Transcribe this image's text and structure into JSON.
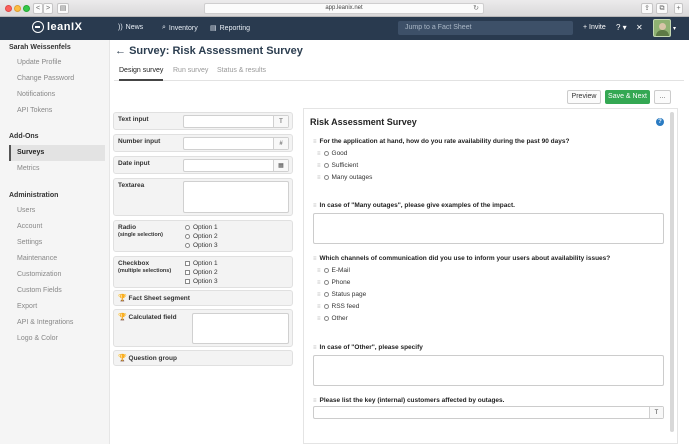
{
  "browser": {
    "url": "app.leanix.net",
    "back": "<",
    "forward": ">",
    "sidebar_toggle": "▤",
    "reload": "↻",
    "share": "⇪",
    "tabs": "⧉",
    "plus": "+"
  },
  "header": {
    "logo": "leanIX",
    "nav": [
      {
        "label": "News",
        "icon": "rss-icon"
      },
      {
        "label": "Inventory",
        "icon": "search-icon"
      },
      {
        "label": "Reporting",
        "icon": "chart-icon"
      }
    ],
    "search_placeholder": "Jump to a Fact Sheet",
    "invite": "+ Invite",
    "help": "?",
    "settings": "✕"
  },
  "sidebar": {
    "user_name": "Sarah Weissenfels",
    "user_items": [
      "Update Profile",
      "Change Password",
      "Notifications",
      "API Tokens"
    ],
    "addons_title": "Add-Ons",
    "addons_items": [
      "Surveys",
      "Metrics"
    ],
    "admin_title": "Administration",
    "admin_items": [
      "Users",
      "Account",
      "Settings",
      "Maintenance",
      "Customization",
      "Custom Fields",
      "Export",
      "API & Integrations",
      "Logo & Color"
    ]
  },
  "page": {
    "back": "←",
    "title": "Survey: Risk Assessment Survey",
    "tabs": [
      "Design survey",
      "Run survey",
      "Status & results"
    ],
    "preview_btn": "Preview",
    "save_btn": "Save & Next",
    "more_btn": "..."
  },
  "palette": {
    "text_input": "Text input",
    "text_icon": "T",
    "number_input": "Number input",
    "number_icon": "#",
    "date_input": "Date input",
    "date_icon": "▦",
    "textarea": "Textarea",
    "radio": "Radio",
    "radio_sub": "(single selection)",
    "radio_options": [
      "Option 1",
      "Option 2",
      "Option 3"
    ],
    "checkbox": "Checkbox",
    "checkbox_sub": "(multiple selections)",
    "checkbox_options": [
      "Option 1",
      "Option 2",
      "Option 3"
    ],
    "fact_sheet_segment": "Fact Sheet segment",
    "calculated_field": "Calculated field",
    "question_group": "Question group",
    "trophy": "🏆"
  },
  "survey": {
    "title": "Risk Assessment Survey",
    "help": "?",
    "drag": "≡",
    "q1": "For the application at hand, how do you rate availability during the past 90 days?",
    "q1_options": [
      "Good",
      "Sufficient",
      "Many outages"
    ],
    "q2": "In case of \"Many outages\", please give examples of the impact.",
    "q3": "Which channels of communication did you use to inform your users about availability issues?",
    "q3_options": [
      "E-Mail",
      "Phone",
      "Status page",
      "RSS feed",
      "Other"
    ],
    "q4": "In case of \"Other\", please specify",
    "q5": "Please list the key (internal) customers affected by outages.",
    "q5_icon": "T"
  }
}
